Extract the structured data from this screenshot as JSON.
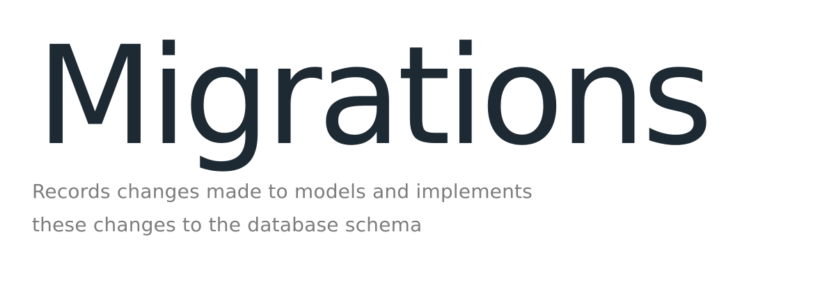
{
  "slide": {
    "title": "Migrations",
    "subtitle_lines": [
      "Records changes made to models and implements",
      "these changes to the database schema"
    ]
  }
}
